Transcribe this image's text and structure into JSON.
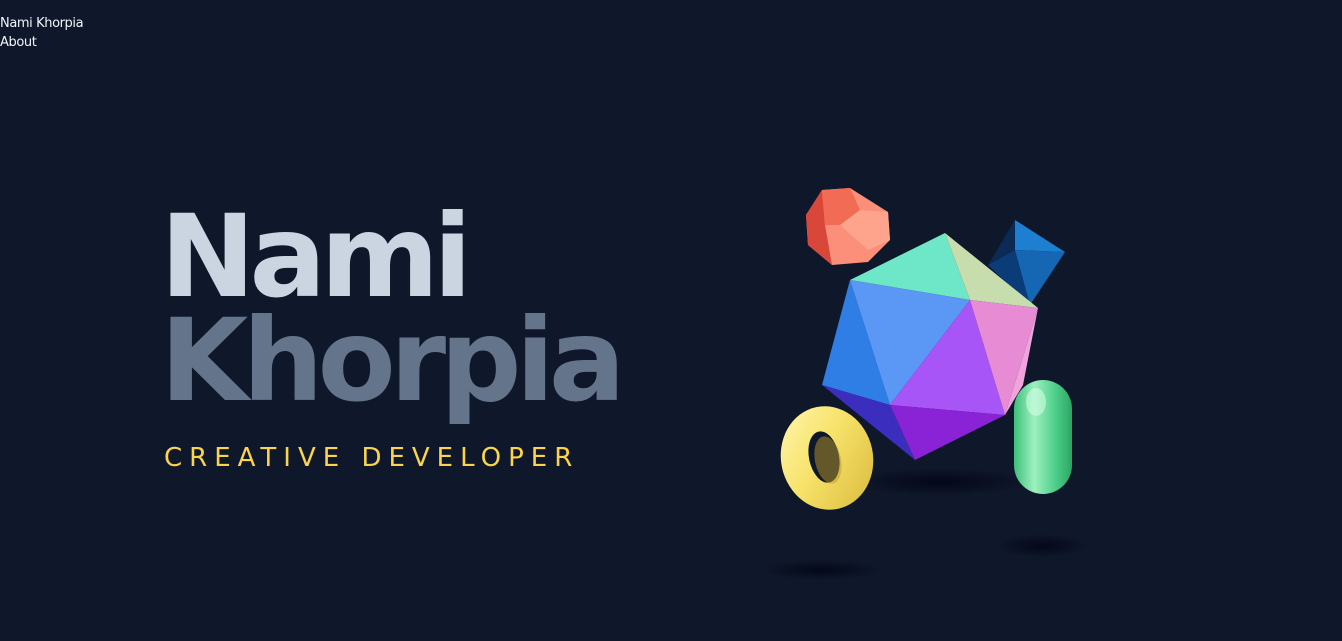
{
  "nav": {
    "home_label": "Nami Khorpia",
    "about_label": "About"
  },
  "hero": {
    "first_name": "Nami",
    "last_name": "Khorpia",
    "tagline": "CREATIVE DEVELOPER"
  },
  "colors": {
    "background": "#0f172a",
    "first_name": "#cbd5e1",
    "last_name": "#64748b",
    "tagline": "#fcd34d"
  },
  "scene": {
    "shapes": [
      "icosahedron",
      "dodecahedron",
      "octahedron",
      "torus",
      "capsule"
    ]
  }
}
